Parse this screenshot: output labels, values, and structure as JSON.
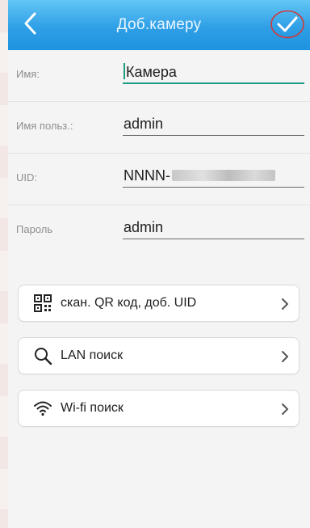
{
  "header": {
    "title": "Доб.камеру",
    "bg_top": "#63c6f5",
    "bg_bottom": "#1e93df",
    "confirm_mark_color": "#d0393b"
  },
  "form": {
    "name": {
      "label": "Имя:",
      "value": "Камера"
    },
    "username": {
      "label": "Имя польз.:",
      "value": "admin"
    },
    "uid": {
      "label": "UID:",
      "value": "NNNN-"
    },
    "password": {
      "label": "Пароль",
      "value": "admin"
    }
  },
  "actions": [
    {
      "label": "скан. QR код, доб. UID",
      "icon": "qr-code-icon"
    },
    {
      "label": "LAN поиск",
      "icon": "search-icon"
    },
    {
      "label": "Wi-fi поиск",
      "icon": "wifi-icon"
    }
  ]
}
